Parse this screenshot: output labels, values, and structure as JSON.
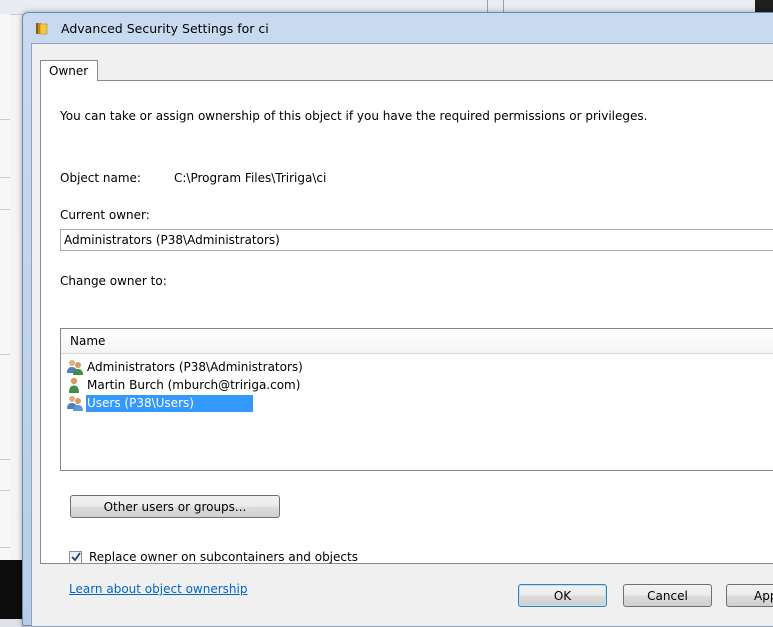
{
  "window": {
    "title": "Advanced Security Settings for ci",
    "title_icon": "folder-icon"
  },
  "tabs": [
    {
      "label": "Owner",
      "selected": true
    }
  ],
  "owner_tab": {
    "intro": "You can take or assign ownership of this object if you have the required permissions or privileges.",
    "object_name_label": "Object name:",
    "object_name_value": "C:\\Program Files\\Tririga\\ci",
    "current_owner_label": "Current owner:",
    "current_owner_value": "Administrators (P38\\Administrators)",
    "change_owner_label": "Change owner to:",
    "list": {
      "column_header": "Name",
      "items": [
        {
          "label": "Administrators (P38\\Administrators)",
          "icon": "group-icon",
          "selected": false
        },
        {
          "label": "Martin Burch (mburch@tririga.com)",
          "icon": "user-icon",
          "selected": false
        },
        {
          "label": "Users (P38\\Users)",
          "icon": "group-icon",
          "selected": true
        }
      ]
    },
    "other_users_button": "Other users or groups...",
    "replace_owner_checkbox": {
      "label": "Replace owner on subcontainers and objects",
      "checked": true
    },
    "learn_link": "Learn about object ownership"
  },
  "buttons": {
    "ok": "OK",
    "cancel": "Cancel",
    "apply": "Apply"
  },
  "colors": {
    "selection": "#3399ff",
    "link": "#0066cc",
    "title_bar": "#c9daf0"
  }
}
